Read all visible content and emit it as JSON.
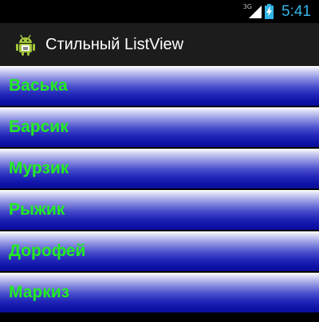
{
  "status_bar": {
    "network_type": "3G",
    "time": "5:41",
    "time_color": "#33b5e5"
  },
  "action_bar": {
    "app_icon": "android-robot-icon",
    "title": "Стильный ListView"
  },
  "list": {
    "label_color": "#22ee22",
    "items": [
      {
        "label": "Васька"
      },
      {
        "label": "Барсик"
      },
      {
        "label": "Мурзик"
      },
      {
        "label": "Рыжик"
      },
      {
        "label": "Дорофей"
      },
      {
        "label": "Маркиз"
      }
    ]
  }
}
